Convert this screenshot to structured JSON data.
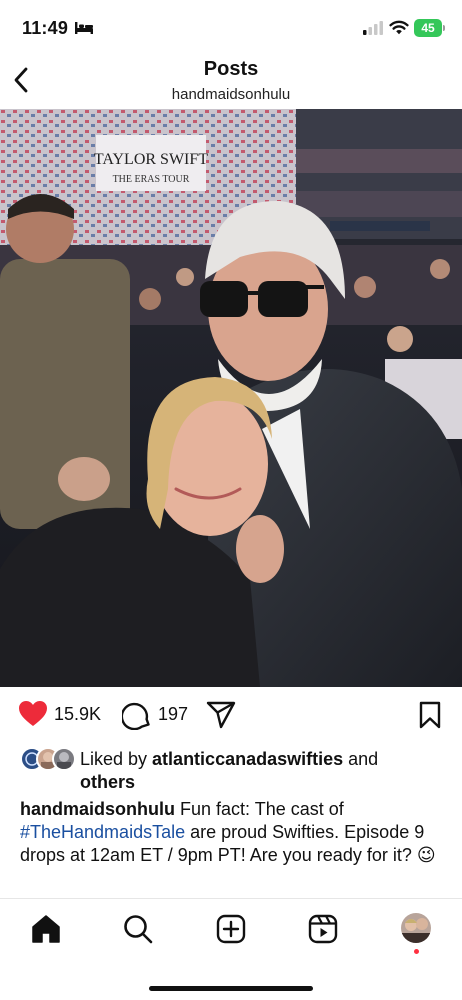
{
  "status_bar": {
    "time": "11:49",
    "battery": "45",
    "icons": [
      "bed-icon",
      "signal-icon",
      "wifi-icon",
      "battery-icon"
    ]
  },
  "header": {
    "title": "Posts",
    "subtitle": "handmaidsonhulu",
    "back_icon": "chevron-left-icon"
  },
  "photo": {
    "screen_line1": "TAYLOR SWIFT",
    "screen_line2": "THE ERAS TOUR"
  },
  "actions": {
    "like_count": "15.9K",
    "comment_count": "197",
    "icons": [
      "heart-icon",
      "comment-icon",
      "share-icon",
      "bookmark-icon"
    ],
    "heart_color": "#ed2b3a"
  },
  "liked_by": {
    "prefix": "Liked by ",
    "user": "atlanticcanadaswifties",
    "suffix": " and",
    "others": "others"
  },
  "caption": {
    "username": "handmaidsonhulu",
    "text_before": " Fun fact: The cast of ",
    "hashtag": "#TheHandmaidsTale",
    "text_after": " are proud Swifties. Episode 9 drops at 12am ET / 9pm PT! Are you ready for it? 😉",
    "hashtag_color": "#1a4fa0"
  },
  "bottom_nav": {
    "items": [
      "home-icon",
      "search-icon",
      "create-icon",
      "reels-icon",
      "profile-avatar"
    ]
  }
}
